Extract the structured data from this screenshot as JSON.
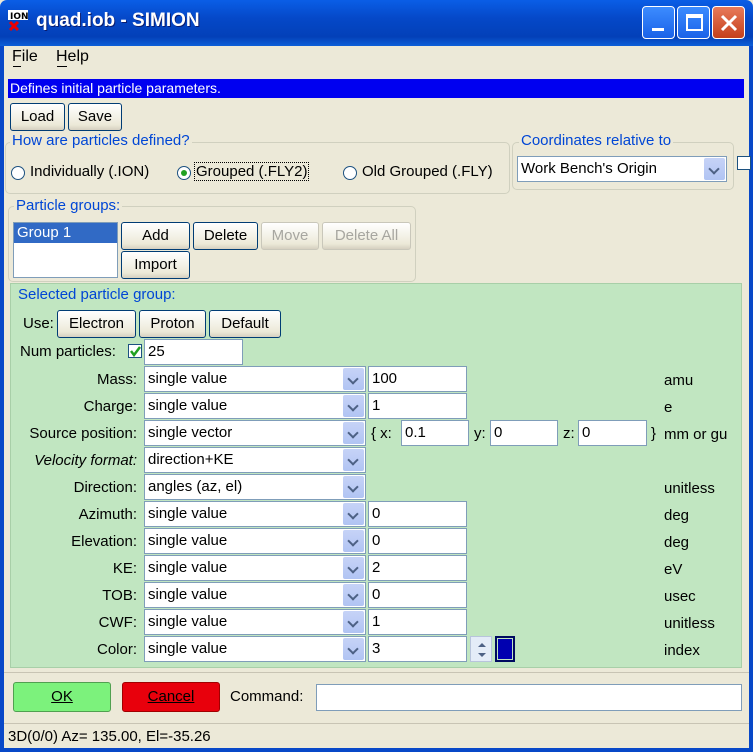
{
  "window": {
    "title": "quad.iob - SIMION",
    "app_icon_text": "ION"
  },
  "menu": {
    "items": [
      "File",
      "Help"
    ]
  },
  "info_bar": "Defines initial particle parameters.",
  "toolbar": {
    "load": "Load",
    "save": "Save"
  },
  "definition": {
    "label": "How are particles defined?",
    "options": [
      "Individually (.ION)",
      "Grouped (.FLY2)",
      "Old Grouped (.FLY)"
    ],
    "selected": "Grouped (.FLY2)"
  },
  "coordinates": {
    "label": "Coordinates relative to",
    "value": "Work Bench's Origin"
  },
  "particle_groups": {
    "label": "Particle groups:",
    "items": [
      "Group 1"
    ],
    "add": "Add",
    "delete": "Delete",
    "move": "Move",
    "delete_all": "Delete All",
    "import": "Import"
  },
  "selected_group": {
    "label": "Selected particle group:",
    "use_label": "Use:",
    "presets": [
      "Electron",
      "Proton",
      "Default"
    ],
    "num_particles_label": "Num particles:",
    "num_particles_checked": true,
    "num_particles": "25",
    "rows": [
      {
        "label": "Mass:",
        "mode": "single value",
        "value": "100",
        "unit": "amu"
      },
      {
        "label": "Charge:",
        "mode": "single value",
        "value": "1",
        "unit": "e"
      },
      {
        "label": "Source position:",
        "mode": "single vector",
        "unit": "mm or gu"
      },
      {
        "label": "Velocity format:",
        "mode": "direction+KE"
      },
      {
        "label": "Direction:",
        "mode": "angles (az, el)",
        "unit": "unitless"
      },
      {
        "label": "Azimuth:",
        "mode": "single value",
        "value": "0",
        "unit": "deg"
      },
      {
        "label": "Elevation:",
        "mode": "single value",
        "value": "0",
        "unit": "deg"
      },
      {
        "label": "KE:",
        "mode": "single value",
        "value": "2",
        "unit": "eV"
      },
      {
        "label": "TOB:",
        "mode": "single value",
        "value": "0",
        "unit": "usec"
      },
      {
        "label": "CWF:",
        "mode": "single value",
        "value": "1",
        "unit": "unitless"
      },
      {
        "label": "Color:",
        "mode": "single value",
        "value": "3",
        "unit": "index"
      }
    ],
    "vector": {
      "open": "{ x:",
      "x": "0.1",
      "y_label": "y:",
      "y": "0",
      "z_label": "z:",
      "z": "0",
      "close": "}"
    },
    "color_swatch": "#0000b0"
  },
  "footer": {
    "ok": "OK",
    "cancel": "Cancel",
    "command_label": "Command:",
    "command_value": ""
  },
  "status": "3D(0/0) Az= 135.00, El=-35.26",
  "colors": {
    "ok": "#7cf27c",
    "cancel": "#e8000c",
    "panel": "#c1e6c1",
    "info": "#0000f0"
  }
}
